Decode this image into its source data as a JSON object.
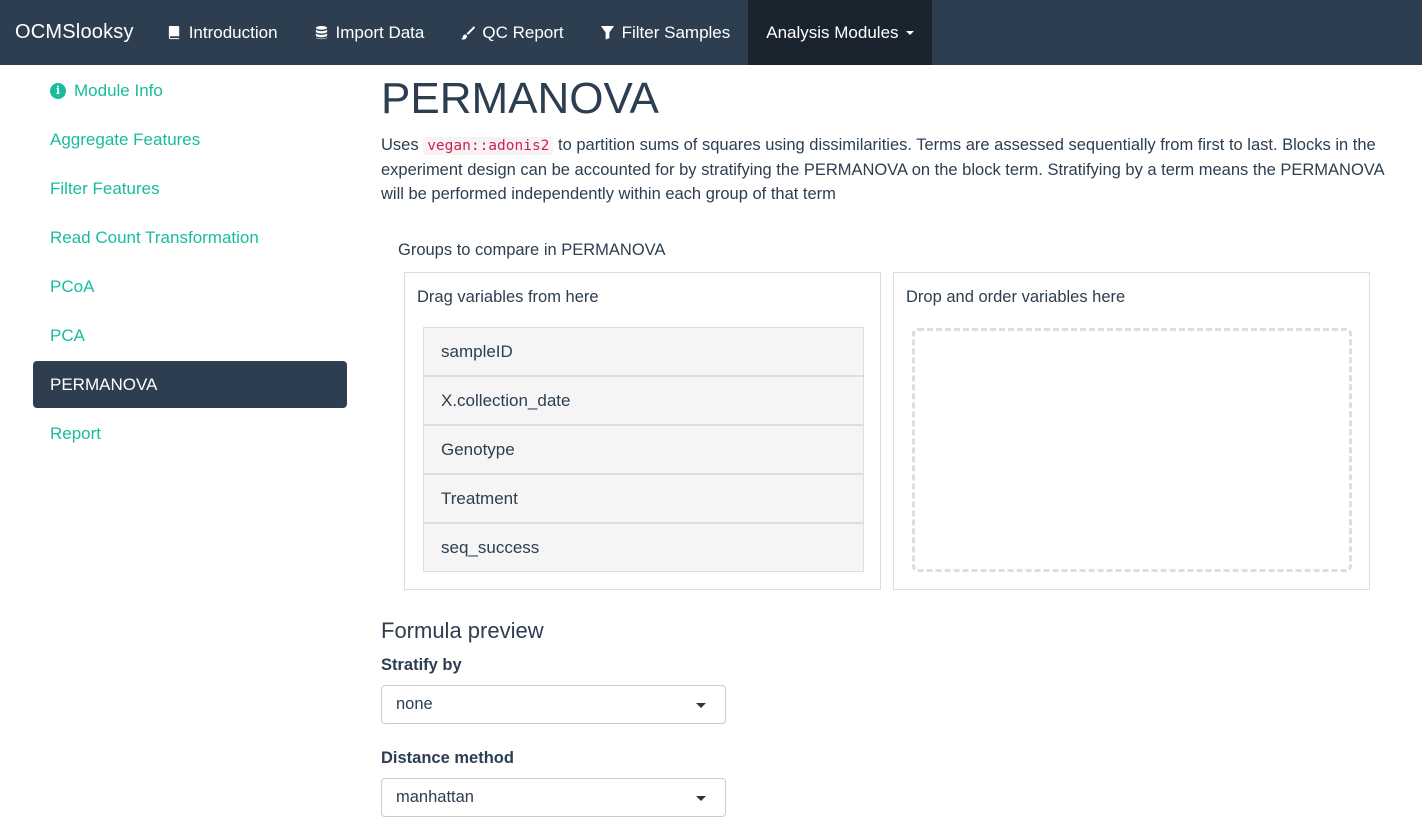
{
  "navbar": {
    "brand": "OCMSlooksy",
    "items": [
      {
        "label": "Introduction",
        "icon": "book-icon"
      },
      {
        "label": "Import Data",
        "icon": "database-icon"
      },
      {
        "label": "QC Report",
        "icon": "paint-brush-icon"
      },
      {
        "label": "Filter Samples",
        "icon": "filter-icon"
      },
      {
        "label": "Analysis Modules",
        "icon": "caret-down-icon"
      }
    ]
  },
  "sidebar": {
    "items": [
      {
        "label": "Module Info",
        "icon": "info-circle-icon"
      },
      {
        "label": "Aggregate Features"
      },
      {
        "label": "Filter Features"
      },
      {
        "label": "Read Count Transformation"
      },
      {
        "label": "PCoA"
      },
      {
        "label": "PCA"
      },
      {
        "label": "PERMANOVA",
        "active": true
      },
      {
        "label": "Report"
      }
    ]
  },
  "main": {
    "title": "PERMANOVA",
    "description_pre": "Uses ",
    "description_code": "vegan::adonis2",
    "description_post": " to partition sums of squares using dissimilarities. Terms are assessed sequentially from first to last. Blocks in the experiment design can be accounted for by stratifying the PERMANOVA on the block term. Stratifying by a term means the PERMANOVA will be performed independently within each group of that term",
    "groups_label": "Groups to compare in PERMANOVA",
    "drag_header": "Drag variables from here",
    "drop_header": "Drop and order variables here",
    "variables": [
      "sampleID",
      "X.collection_date",
      "Genotype",
      "Treatment",
      "seq_success"
    ],
    "formula_preview": "Formula preview",
    "stratify_label": "Stratify by",
    "stratify_value": "none",
    "distance_label": "Distance method",
    "distance_value": "manhattan"
  },
  "colors": {
    "navbar": "#2c3e50",
    "navbar_active": "#1a242f",
    "accent": "#18bc9c",
    "code": "#c7254e"
  }
}
